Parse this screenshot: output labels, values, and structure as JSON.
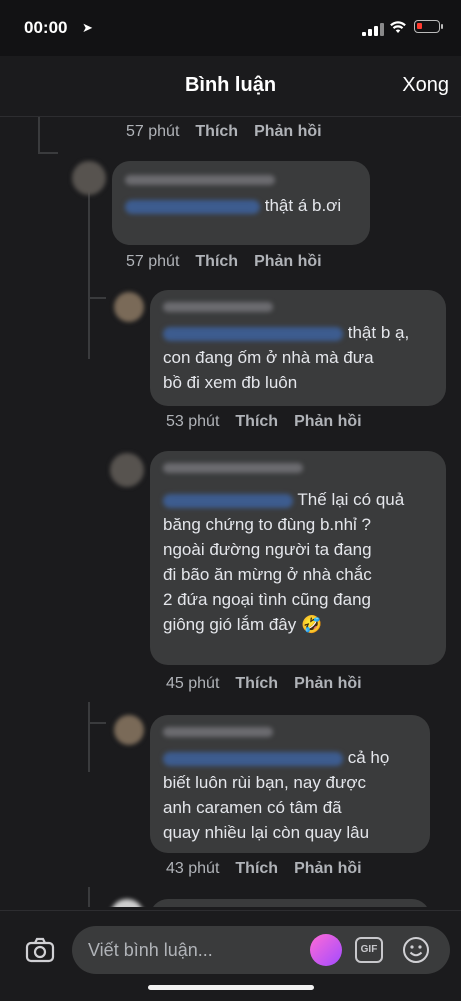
{
  "status": {
    "time": "00:00"
  },
  "header": {
    "title": "Bình luận",
    "done_label": "Xong"
  },
  "actions": {
    "like": "Thích",
    "reply": "Phản hồi"
  },
  "comments": [
    {
      "time": "57 phút"
    },
    {
      "text": "thật á b.ơi",
      "time": "57 phút"
    },
    {
      "text": "thật b ạ,\ncon đang ốm ở nhà mà đưa\nbồ đi xem đb luôn",
      "time": "53 phút"
    },
    {
      "text": "Thế lại có quả\nbăng chứng to đùng b.nhỉ ?\nngoài đường người ta đang\nđi bão ăn mừng ở nhà chắc\n2 đứa ngoại tình cũng đang\ngiông gió lắm đây 🤣",
      "time": "45 phút"
    },
    {
      "text": "cả họ\nbiết luôn rùi bạn, nay được\nanh caramen có tâm đã\nquay nhiều lại còn quay lâu",
      "time": "43 phút"
    }
  ],
  "composer": {
    "placeholder": "Viết bình luận...",
    "gif_label": "GIF"
  }
}
